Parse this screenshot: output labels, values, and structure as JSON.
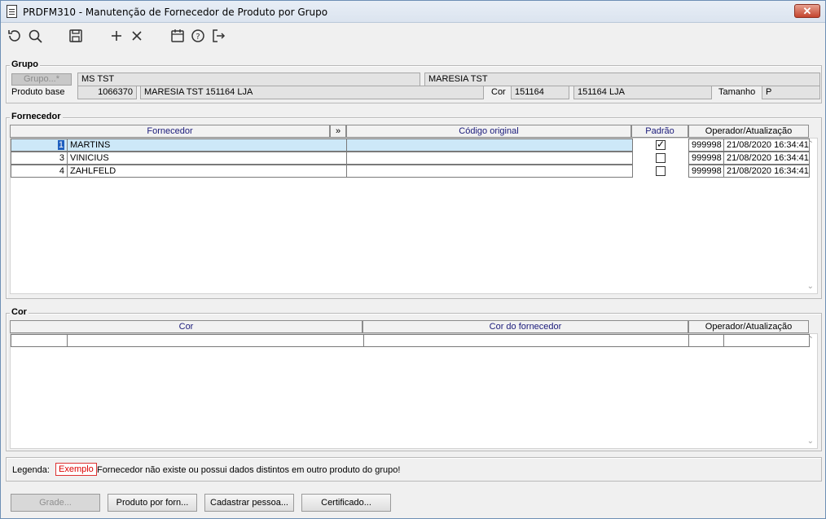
{
  "window": {
    "title": "PRDFM310 - Manutenção de Fornecedor de Produto por Grupo",
    "close_label": "✕"
  },
  "toolbar": {
    "icons": [
      "undo-icon",
      "search-icon",
      "save-icon",
      "add-icon",
      "delete-icon",
      "calendar-icon",
      "help-icon",
      "exit-icon"
    ]
  },
  "grupo": {
    "section_label": "Grupo",
    "grupo_button": "Grupo...*",
    "grupo_code": "MS TST",
    "grupo_desc": "MARESIA TST",
    "produto_base_label": "Produto base",
    "produto_base_code": "1066370",
    "produto_base_desc": "MARESIA TST 151164 LJA",
    "cor_label": "Cor",
    "cor_code": "151164",
    "cor_desc": "151164 LJA",
    "tamanho_label": "Tamanho",
    "tamanho_value": "P"
  },
  "fornecedor": {
    "section_label": "Fornecedor",
    "columns": {
      "fornecedor": "Fornecedor",
      "expand": "»",
      "codigo": "Código original",
      "padrao": "Padrão",
      "operador": "Operador/Atualização"
    },
    "rows": [
      {
        "id": "1",
        "name": "MARTINS",
        "codigo": "",
        "padrao": true,
        "operador": "999998",
        "data": "21/08/2020 16:34:41"
      },
      {
        "id": "3",
        "name": "VINICIUS",
        "codigo": "",
        "padrao": false,
        "operador": "999998",
        "data": "21/08/2020 16:34:41"
      },
      {
        "id": "4",
        "name": "ZAHLFELD",
        "codigo": "",
        "padrao": false,
        "operador": "999998",
        "data": "21/08/2020 16:34:41"
      }
    ]
  },
  "cor_section": {
    "section_label": "Cor",
    "columns": {
      "cor": "Cor",
      "cor_fornecedor": "Cor do fornecedor",
      "operador": "Operador/Atualização"
    }
  },
  "legenda": {
    "label": "Legenda:",
    "example": "Exemplo",
    "text": "Fornecedor não existe ou possui dados distintos em outro produto do grupo!"
  },
  "buttons": {
    "grade": "Grade...",
    "produto_por_forn": "Produto por forn...",
    "cadastrar_pessoa": "Cadastrar pessoa...",
    "certificado": "Certificado..."
  },
  "colors": {
    "selected_row": "#cde8f8",
    "header_text": "#1a1a7a",
    "legend_red": "#dd0000"
  }
}
